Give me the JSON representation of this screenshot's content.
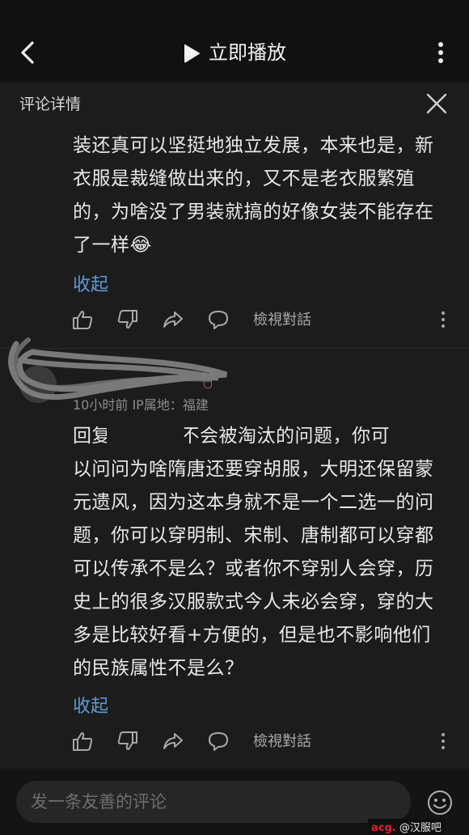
{
  "header": {
    "title": "立即播放"
  },
  "detail": {
    "title": "评论详情"
  },
  "comments": [
    {
      "text": "装还真可以坚挺地独立发展，本来也是，新\n衣服是裁缝做出来的，又不是老衣服繁殖\n的，为啥没了男装就搞的好像女装不能存在\n了一样😂",
      "collapse_label": "收起",
      "view_conversation": "檢視對話"
    },
    {
      "author": "",
      "meta": "10小时前  IP属地：福建",
      "text": "回复         :至于会不会被淘汰的问题，你可\n以问问为啥隋唐还要穿胡服，大明还保留蒙\n元遗风，因为这本身就不是一个二选一的问\n题，你可以穿明制、宋制、唐制都可以穿都\n可以传承不是么？或者你不穿别人会穿，历\n史上的很多汉服款式今人未必会穿，穿的大\n多是比较好看+方便的，但是也不影响他们\n的民族属性不是么？",
      "collapse_label": "收起",
      "view_conversation": "檢視對話"
    }
  ],
  "footer": {
    "input_placeholder": "发一条友善的评论"
  },
  "watermark": {
    "prefix": "acg.",
    "suffix": " @汉服吧"
  },
  "colors": {
    "link": "#5b9bd5",
    "background": "#1c1c1c"
  }
}
